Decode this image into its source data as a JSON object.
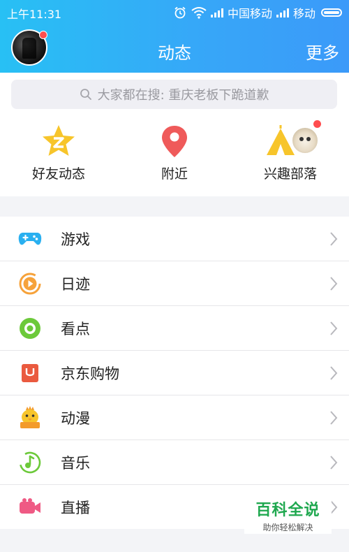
{
  "status_bar": {
    "time": "上午11:31",
    "carrier1": "中国移动",
    "carrier2": "移动"
  },
  "header": {
    "title": "动态",
    "more": "更多"
  },
  "search": {
    "placeholder": "大家都在搜: 重庆老板下跪道歉"
  },
  "quick_actions": [
    {
      "label": "好友动态",
      "icon": "star-z-icon",
      "color": "#f7c52b"
    },
    {
      "label": "附近",
      "icon": "location-pin-icon",
      "color": "#ef5a5a"
    },
    {
      "label": "兴趣部落",
      "icon": "tent-icon",
      "color": "#f7c52b"
    }
  ],
  "menu": [
    {
      "label": "游戏",
      "icon": "gamepad-icon",
      "color": "#2ab0f0"
    },
    {
      "label": "日迹",
      "icon": "play-circle-icon",
      "color": "#f6a23a"
    },
    {
      "label": "看点",
      "icon": "eye-icon",
      "color": "#6cc93a"
    },
    {
      "label": "京东购物",
      "icon": "bag-icon",
      "color": "#ea5a3f"
    },
    {
      "label": "动漫",
      "icon": "chick-icon",
      "color": "#f7c52b"
    },
    {
      "label": "音乐",
      "icon": "music-note-icon",
      "color": "#6cc93a"
    },
    {
      "label": "直播",
      "icon": "video-camera-icon",
      "color": "#ef5a84"
    }
  ],
  "watermark": {
    "title": "百科全说",
    "subtitle": "助你轻松解决"
  },
  "colors": {
    "header_start": "#28c0f4",
    "header_end": "#3b9af9",
    "notification": "#ff4d4f"
  }
}
